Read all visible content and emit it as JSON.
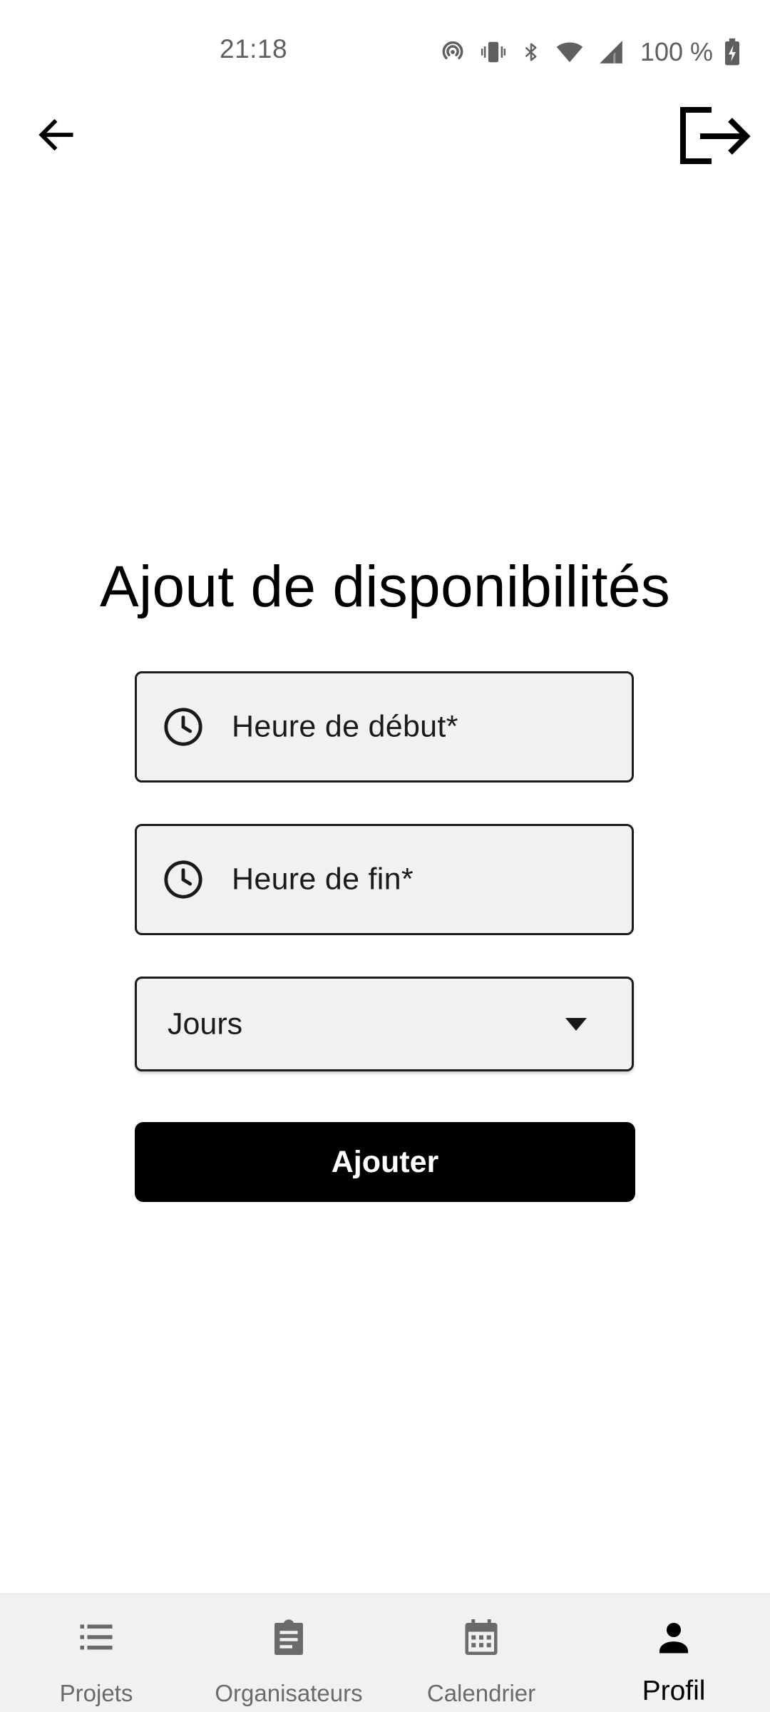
{
  "status_bar": {
    "time": "21:18",
    "battery": "100 %",
    "icons": [
      "hotspot-icon",
      "vibrate-icon",
      "bluetooth-icon",
      "wifi-icon",
      "cell-signal-icon",
      "battery-charging-icon"
    ]
  },
  "app_bar": {
    "back_icon": "arrow-left-icon",
    "logout_icon": "logout-icon"
  },
  "page": {
    "title": "Ajout de disponibilités"
  },
  "form": {
    "start_time_label": "Heure de début*",
    "end_time_label": "Heure de fin*",
    "days_select": "Jours",
    "submit_label": "Ajouter"
  },
  "bottom_nav": {
    "items": [
      {
        "label": "Projets",
        "icon": "list-icon",
        "active": false
      },
      {
        "label": "Organisateurs",
        "icon": "clipboard-icon",
        "active": false
      },
      {
        "label": "Calendrier",
        "icon": "calendar-icon",
        "active": false
      },
      {
        "label": "Profil",
        "icon": "person-icon",
        "active": true
      }
    ]
  },
  "colors": {
    "background": "#ffffff",
    "field_background": "#f1f1f1",
    "button_background": "#000000",
    "nav_background": "#f1f1f1",
    "inactive_nav": "#6a6a6a"
  }
}
